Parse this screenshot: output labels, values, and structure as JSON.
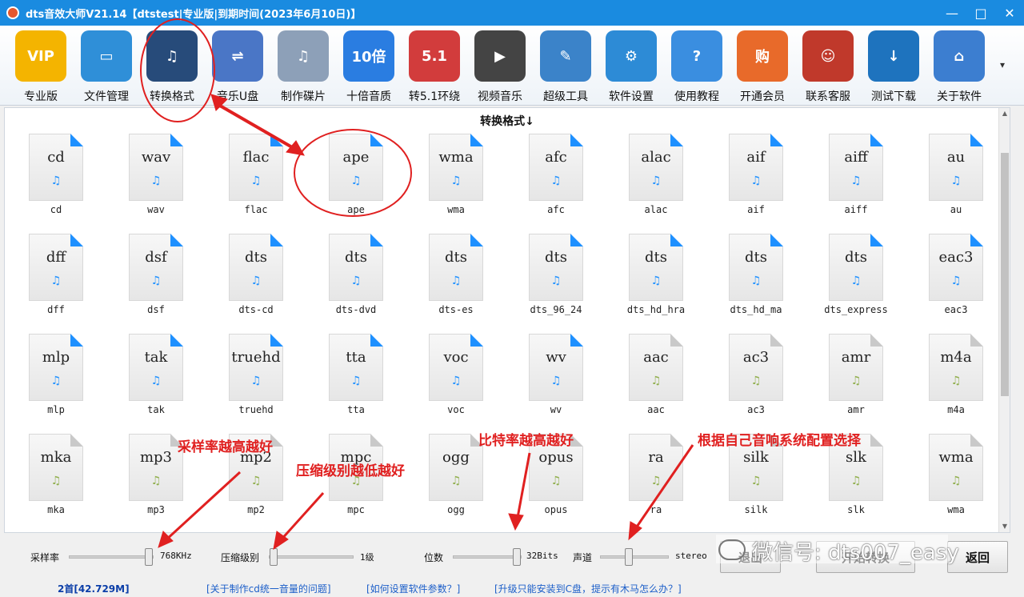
{
  "window": {
    "title": "dts音效大师V21.14【dtstest|专业版|到期时间(2023年6月10日)】",
    "controls": [
      "—",
      "□",
      "✕"
    ]
  },
  "toolbar": {
    "items": [
      {
        "label": "专业版",
        "icon": "vip-icon",
        "color": "#f4b400",
        "glyph": "VIP"
      },
      {
        "label": "文件管理",
        "icon": "folder-icon",
        "color": "#2f8fd8",
        "glyph": "▭"
      },
      {
        "label": "转换格式",
        "icon": "music-note-icon",
        "color": "#274b7a",
        "glyph": "♫"
      },
      {
        "label": "音乐U盘",
        "icon": "usb-drive-icon",
        "color": "#4a76c6",
        "glyph": "⇌"
      },
      {
        "label": "制作碟片",
        "icon": "disc-icon",
        "color": "#8da0b8",
        "glyph": "♫"
      },
      {
        "label": "十倍音质",
        "icon": "headphones-10x-icon",
        "color": "#2a7de1",
        "glyph": "10倍"
      },
      {
        "label": "转5.1环绕",
        "icon": "surround-51-icon",
        "color": "#d23c3c",
        "glyph": "5.1"
      },
      {
        "label": "视频音乐",
        "icon": "clapperboard-icon",
        "color": "#444444",
        "glyph": "▶"
      },
      {
        "label": "超级工具",
        "icon": "tools-icon",
        "color": "#3b83c9",
        "glyph": "✎"
      },
      {
        "label": "软件设置",
        "icon": "gear-icon",
        "color": "#2d8bd6",
        "glyph": "⚙"
      },
      {
        "label": "使用教程",
        "icon": "help-icon",
        "color": "#3a8ee0",
        "glyph": "?"
      },
      {
        "label": "开通会员",
        "icon": "shopping-icon",
        "color": "#e86a2a",
        "glyph": "购"
      },
      {
        "label": "联系客服",
        "icon": "support-agent-icon",
        "color": "#c0392b",
        "glyph": "☺"
      },
      {
        "label": "测试下载",
        "icon": "download-arrow-icon",
        "color": "#1e73be",
        "glyph": "↓"
      },
      {
        "label": "关于软件",
        "icon": "computer-globe-icon",
        "color": "#3c7ed0",
        "glyph": "⌂"
      }
    ],
    "more": "▾"
  },
  "content": {
    "title": "转换格式↓",
    "formats": [
      {
        "ext": "cd",
        "name": "cd",
        "lossless": true
      },
      {
        "ext": "wav",
        "name": "wav",
        "lossless": true
      },
      {
        "ext": "flac",
        "name": "flac",
        "lossless": true
      },
      {
        "ext": "ape",
        "name": "ape",
        "lossless": true
      },
      {
        "ext": "wma",
        "name": "wma",
        "lossless": true
      },
      {
        "ext": "afc",
        "name": "afc",
        "lossless": true
      },
      {
        "ext": "alac",
        "name": "alac",
        "lossless": true
      },
      {
        "ext": "aif",
        "name": "aif",
        "lossless": true
      },
      {
        "ext": "aiff",
        "name": "aiff",
        "lossless": true
      },
      {
        "ext": "au",
        "name": "au",
        "lossless": true
      },
      {
        "ext": "dff",
        "name": "dff",
        "lossless": true
      },
      {
        "ext": "dsf",
        "name": "dsf",
        "lossless": true
      },
      {
        "ext": "dts",
        "name": "dts-cd",
        "lossless": true
      },
      {
        "ext": "dts",
        "name": "dts-dvd",
        "lossless": true
      },
      {
        "ext": "dts",
        "name": "dts-es",
        "lossless": true
      },
      {
        "ext": "dts",
        "name": "dts_96_24",
        "lossless": true
      },
      {
        "ext": "dts",
        "name": "dts_hd_hra",
        "lossless": true
      },
      {
        "ext": "dts",
        "name": "dts_hd_ma",
        "lossless": true
      },
      {
        "ext": "dts",
        "name": "dts_express",
        "lossless": true
      },
      {
        "ext": "eac3",
        "name": "eac3",
        "lossless": true
      },
      {
        "ext": "mlp",
        "name": "mlp",
        "lossless": true
      },
      {
        "ext": "tak",
        "name": "tak",
        "lossless": true
      },
      {
        "ext": "truehd",
        "name": "truehd",
        "lossless": true
      },
      {
        "ext": "tta",
        "name": "tta",
        "lossless": true
      },
      {
        "ext": "voc",
        "name": "voc",
        "lossless": true
      },
      {
        "ext": "wv",
        "name": "wv",
        "lossless": true
      },
      {
        "ext": "aac",
        "name": "aac",
        "lossless": false
      },
      {
        "ext": "ac3",
        "name": "ac3",
        "lossless": false
      },
      {
        "ext": "amr",
        "name": "amr",
        "lossless": false
      },
      {
        "ext": "m4a",
        "name": "m4a",
        "lossless": false
      },
      {
        "ext": "mka",
        "name": "mka",
        "lossless": false
      },
      {
        "ext": "mp3",
        "name": "mp3",
        "lossless": false
      },
      {
        "ext": "mp2",
        "name": "mp2",
        "lossless": false
      },
      {
        "ext": "mpc",
        "name": "mpc",
        "lossless": false
      },
      {
        "ext": "ogg",
        "name": "ogg",
        "lossless": false
      },
      {
        "ext": "opus",
        "name": "opus",
        "lossless": false
      },
      {
        "ext": "ra",
        "name": "ra",
        "lossless": false
      },
      {
        "ext": "silk",
        "name": "silk",
        "lossless": false
      },
      {
        "ext": "slk",
        "name": "slk",
        "lossless": false
      },
      {
        "ext": "wma",
        "name": "wma",
        "lossless": false
      }
    ]
  },
  "controls": {
    "sample_rate": {
      "label": "采样率",
      "value": "768KHz",
      "level": 1.0
    },
    "compression": {
      "label": "压缩级别",
      "value": "1级",
      "level": 0.0
    },
    "bit_depth": {
      "label": "位数",
      "value": "32Bits",
      "level": 1.0
    },
    "channel": {
      "label": "声道",
      "value": "stereo",
      "level": 0.4
    },
    "exit_button": "退出",
    "start_button": "开始转换",
    "return_button": "返回"
  },
  "status": {
    "count": "2首[42.729M]",
    "links": [
      "[关于制作cd统一音量的问题]",
      "[如何设置软件参数？]",
      "[升级只能安装到C盘，提示有木马怎么办？]"
    ]
  },
  "annotations": {
    "sample": "采样率越高越好",
    "compress": "压缩级别越低越好",
    "bitrate": "比特率越高越好",
    "speaker": "根据自己音响系统配置选择",
    "accent": "#e02020"
  },
  "watermark": "微信号: dts007_easy"
}
